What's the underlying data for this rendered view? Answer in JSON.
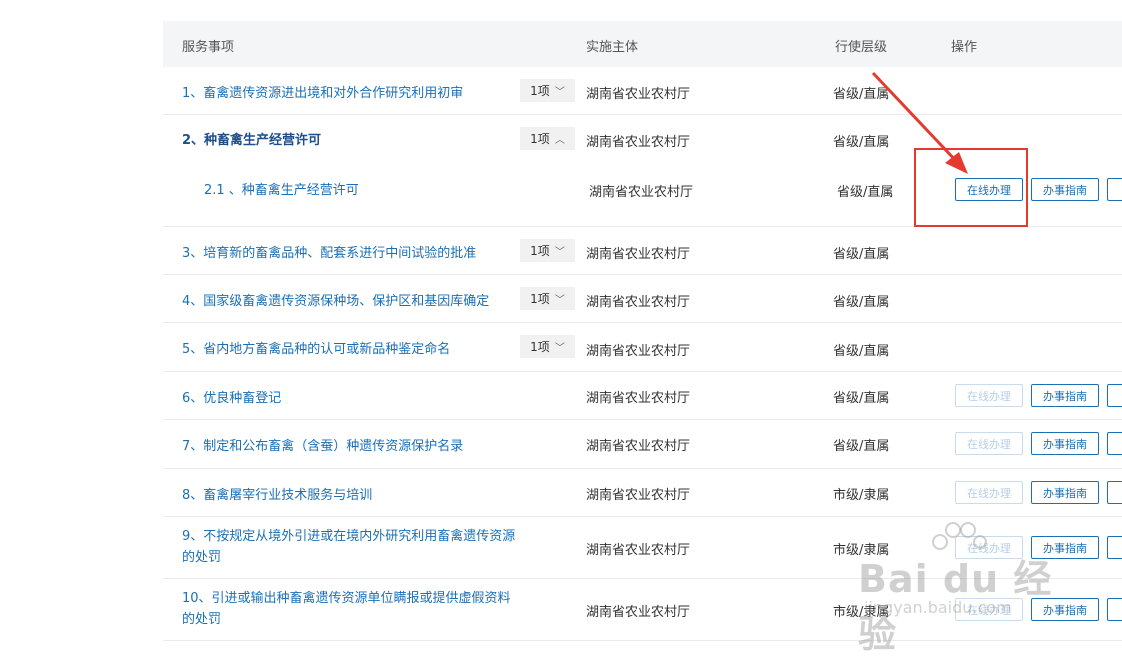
{
  "header": {
    "col_name": "服务事项",
    "col_org": "实施主体",
    "col_level": "行使层级",
    "col_action": "操作"
  },
  "rows": [
    {
      "name": "1、畜禽遗传资源进出境和对外合作研究利用初审",
      "badge": "1项",
      "chevron": "chevron-down-icon",
      "org": "湖南省农业农村厅",
      "level": "省级/直属"
    },
    {
      "name": "2、种畜禽生产经营许可",
      "badge": "1项",
      "chevron": "chevron-up-icon",
      "org": "湖南省农业农村厅",
      "level": "省级/直属"
    },
    {
      "name": "2.1 、种畜禽生产经营许可",
      "org": "湖南省农业农村厅",
      "level": "省级/直属",
      "online": "在线办理",
      "guide": "办事指南"
    },
    {
      "name": "3、培育新的畜禽品种、配套系进行中间试验的批准",
      "badge": "1项",
      "chevron": "chevron-down-icon",
      "org": "湖南省农业农村厅",
      "level": "省级/直属"
    },
    {
      "name": "4、国家级畜禽遗传资源保种场、保护区和基因库确定",
      "badge": "1项",
      "chevron": "chevron-down-icon",
      "org": "湖南省农业农村厅",
      "level": "省级/直属"
    },
    {
      "name": "5、省内地方畜禽品种的认可或新品种鉴定命名",
      "badge": "1项",
      "chevron": "chevron-down-icon",
      "org": "湖南省农业农村厅",
      "level": "省级/直属"
    },
    {
      "name": "6、优良种畜登记",
      "org": "湖南省农业农村厅",
      "level": "省级/直属",
      "online": "在线办理",
      "guide": "办事指南"
    },
    {
      "name": "7、制定和公布畜禽（含蚕）种遗传资源保护名录",
      "org": "湖南省农业农村厅",
      "level": "省级/直属",
      "online": "在线办理",
      "guide": "办事指南"
    },
    {
      "name": "8、畜禽屠宰行业技术服务与培训",
      "org": "湖南省农业农村厅",
      "level": "市级/隶属",
      "online": "在线办理",
      "guide": "办事指南"
    },
    {
      "name": "9、不按规定从境外引进或在境内外研究利用畜禽遗传资源的处罚",
      "org": "湖南省农业农村厅",
      "level": "市级/隶属",
      "online": "在线办理",
      "guide": "办事指南"
    },
    {
      "name": "10、引进或输出种畜禽遗传资源单位瞒报或提供虚假资料的处罚",
      "org": "湖南省农业农村厅",
      "level": "市级/隶属",
      "online": "在线办理",
      "guide": "办事指南"
    }
  ],
  "watermark": {
    "logo": "Bai du 经验",
    "url": "jingyan.baidu.com"
  },
  "colors": {
    "link": "#1a6fb5",
    "annotation": "#e43a2f",
    "header_bg": "#f4f5f7"
  }
}
